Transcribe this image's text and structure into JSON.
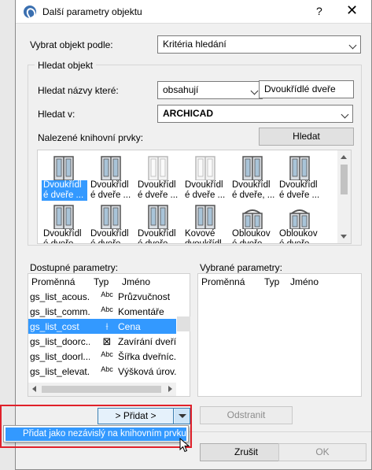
{
  "window": {
    "title": "Další parametry objektu",
    "help_label": "?",
    "close_label": "✕"
  },
  "select_by": {
    "label": "Vybrat objekt podle:",
    "value": "Kritéria hledání"
  },
  "search_group": {
    "title": "Hledat objekt",
    "names_label": "Hledat názvy které:",
    "condition_value": "obsahují",
    "search_text": "Dvoukřídlé dveře",
    "search_in_label": "Hledat v:",
    "search_in_value": "ARCHICAD",
    "found_label": "Nalezené knihovní prvky:",
    "search_button": "Hledat"
  },
  "library_items": [
    {
      "caption": "Dvoukřídl é dveře ...",
      "selected": true
    },
    {
      "caption": "Dvoukřídl é dveře ...",
      "selected": false
    },
    {
      "caption": "Dvoukřídl é dveře ...",
      "selected": false
    },
    {
      "caption": "Dvoukřídl é dveře ...",
      "selected": false
    },
    {
      "caption": "Dvoukřídl é dveře, ...",
      "selected": false
    },
    {
      "caption": "Dvoukřídl é dveře ...",
      "selected": false
    },
    {
      "caption": "Dvoukřídl é dveře",
      "selected": false
    },
    {
      "caption": "Dvoukřídl é dveře",
      "selected": false
    },
    {
      "caption": "Dvoukřídl é dveře",
      "selected": false
    },
    {
      "caption": "Kovové dvoukřídl",
      "selected": false
    },
    {
      "caption": "Obloukov é dveře",
      "selected": false
    },
    {
      "caption": "Obloukov é dveře",
      "selected": false
    }
  ],
  "available_params": {
    "label": "Dostupné parametry:",
    "headers": {
      "var": "Proměnná",
      "type": "Typ",
      "name": "Jméno"
    },
    "rows": [
      {
        "var": "gs_list_acous...",
        "type": "Abc",
        "name": "Průzvučnost",
        "selected": false
      },
      {
        "var": "gs_list_comm...",
        "type": "Abc",
        "name": "Komentáře",
        "selected": false
      },
      {
        "var": "gs_list_cost",
        "type": "⟊",
        "name": "Cena",
        "selected": true
      },
      {
        "var": "gs_list_doorc...",
        "type": "⊠",
        "name": "Zavírání dveří",
        "selected": false
      },
      {
        "var": "gs_list_doorl...",
        "type": "Abc",
        "name": "Šířka dveřníc...",
        "selected": false
      },
      {
        "var": "gs_list_elevat...",
        "type": "Abc",
        "name": "Výšková úrov...",
        "selected": false
      }
    ]
  },
  "selected_params": {
    "label": "Vybrané parametry:",
    "headers": {
      "var": "Proměnná",
      "type": "Typ",
      "name": "Jméno"
    }
  },
  "buttons": {
    "add": "> Přidat >",
    "remove": "Odstranit",
    "cancel": "Zrušit",
    "ok": "OK"
  },
  "dropdown_menu": {
    "item": "Přidat jako nezávislý na knihovním prvku"
  },
  "colors": {
    "selection": "#3399ff",
    "highlight_border": "#e0202a"
  }
}
